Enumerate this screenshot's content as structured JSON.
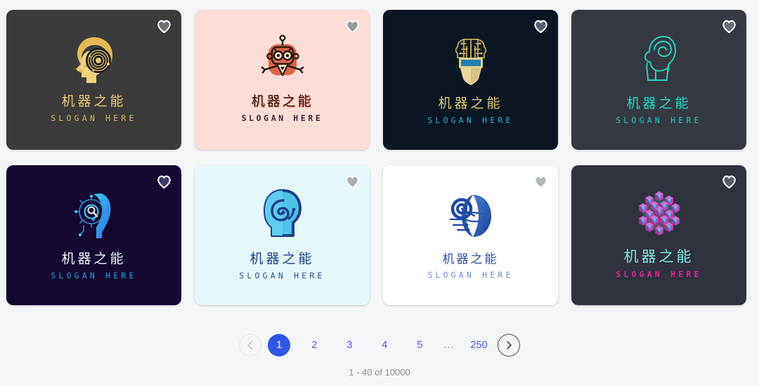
{
  "gallery": {
    "cards": [
      {
        "id": "card-1",
        "brand": "机器之能",
        "slogan": "SLOGAN HERE",
        "bg": "#3b3b3b",
        "mark": "head-spiral-gold-icon",
        "favorite_icon": "heart-icon"
      },
      {
        "id": "card-2",
        "brand": "机器之能",
        "slogan": "SLOGAN HERE",
        "bg": "#fcdcd6",
        "mark": "robot-mascot-icon",
        "favorite_icon": "heart-icon"
      },
      {
        "id": "card-3",
        "brand": "机器之能",
        "slogan": "SLOGAN HERE",
        "bg": "#0b1622",
        "mark": "circuit-brain-shield-icon",
        "favorite_icon": "heart-icon"
      },
      {
        "id": "card-4",
        "brand": "机器之能",
        "slogan": "SLOGAN HERE",
        "bg": "#353a42",
        "mark": "head-outline-teal-icon",
        "favorite_icon": "heart-icon"
      },
      {
        "id": "card-5",
        "brand": "机器之能",
        "slogan": "SLOGAN HERE",
        "bg": "#140830",
        "mark": "head-circuit-profile-icon",
        "favorite_icon": "heart-icon"
      },
      {
        "id": "card-6",
        "brand": "机器之能",
        "slogan": "SLOGAN HERE",
        "bg": "#e6f7fb",
        "mark": "head-swirl-blue-icon",
        "favorite_icon": "heart-icon"
      },
      {
        "id": "card-7",
        "brand": "机器之能",
        "slogan": "SLOGAN HERE",
        "bg": "#ffffff",
        "mark": "planet-face-orbit-icon",
        "favorite_icon": "heart-icon"
      },
      {
        "id": "card-8",
        "brand": "机器之能",
        "slogan": "SLOGAN HERE",
        "bg": "#2e323d",
        "mark": "cube-cluster-neon-icon",
        "favorite_icon": "heart-icon"
      }
    ]
  },
  "pagination": {
    "prev_icon": "chevron-left-icon",
    "next_icon": "chevron-right-icon",
    "pages": [
      {
        "label": "1",
        "active": true
      },
      {
        "label": "2",
        "active": false
      },
      {
        "label": "3",
        "active": false
      },
      {
        "label": "4",
        "active": false
      },
      {
        "label": "5",
        "active": false
      },
      {
        "label": "...",
        "active": false
      },
      {
        "label": "250",
        "active": false
      }
    ],
    "active_page": "1",
    "active_color": "#2f55e8",
    "link_color": "#4a5ce8"
  },
  "result_count": "1 - 40 of 10000"
}
